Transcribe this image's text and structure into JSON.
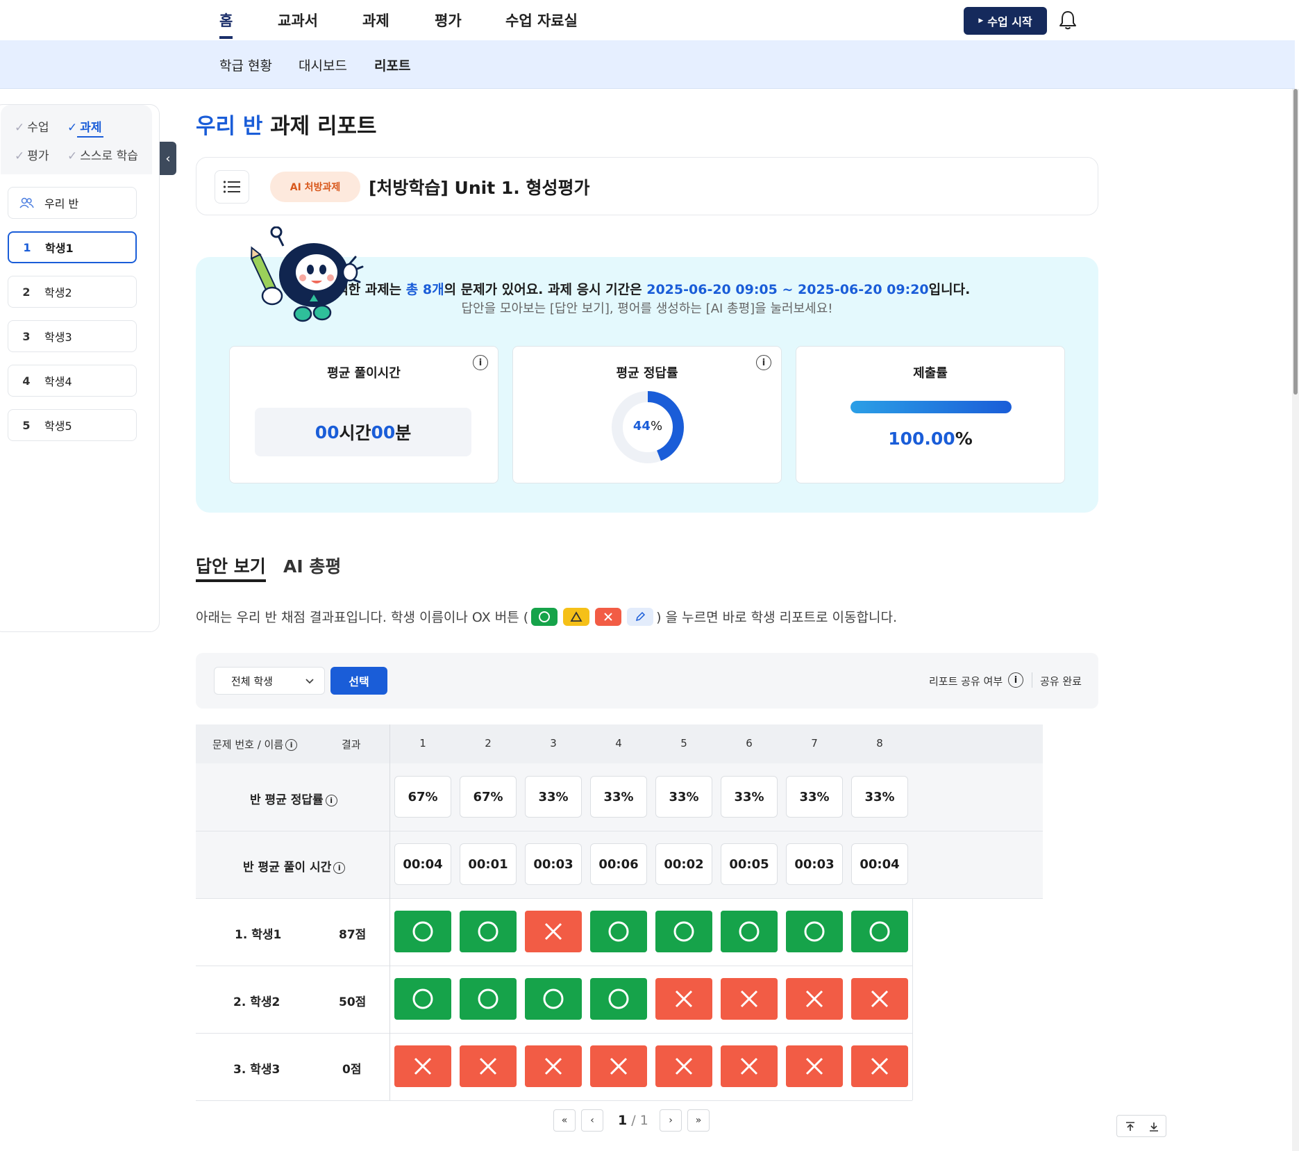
{
  "topnav": {
    "tabs": [
      "홈",
      "교과서",
      "과제",
      "평가",
      "수업 자료실"
    ],
    "start_button": "수업 시작"
  },
  "subnav": {
    "items": [
      "학급 현황",
      "대시보드",
      "리포트"
    ]
  },
  "sidebar": {
    "filters": [
      "수업",
      "과제",
      "평가",
      "스스로 학습"
    ],
    "class_label": "우리 반",
    "students": [
      {
        "num": "1",
        "name": "학생1"
      },
      {
        "num": "2",
        "name": "학생2"
      },
      {
        "num": "3",
        "name": "학생3"
      },
      {
        "num": "4",
        "name": "학생4"
      },
      {
        "num": "5",
        "name": "학생5"
      }
    ]
  },
  "header": {
    "title_highlight": "우리 반",
    "title_rest": " 과제 리포트",
    "badge": "AI 처방과제",
    "assignment_title": "[처방학습] Unit 1. 형성평가"
  },
  "info": {
    "line1_a": "선택한 과제는 ",
    "line1_count": "총 8개",
    "line1_b": "의 문제가 있어요. 과제 응시 기간은 ",
    "line1_period": "2025-06-20 09:05 ~ 2025-06-20 09:20",
    "line1_c": "입니다.",
    "line2": "답안을 모아보는 [답안 보기], 평어를 생성하는 [AI 총평]을 눌러보세요!",
    "stats": {
      "avg_time_title": "평균 풀이시간",
      "avg_time_h": "00",
      "avg_time_h_unit": "시간 ",
      "avg_time_m": "00",
      "avg_time_m_unit": "분",
      "avg_correct_title": "평균 정답률",
      "avg_correct_value": "44",
      "avg_correct_fraction": 0.44,
      "submit_title": "제출률",
      "submit_value": "100.00",
      "submit_fraction": 1.0
    }
  },
  "tabs": [
    "답안 보기",
    "AI 총평"
  ],
  "description": {
    "before": "아래는 우리 반 채점 결과표입니다. 학생 이름이나 OX 버튼 (",
    "after": ") 을 누르면 바로 학생 리포트로 이동합니다."
  },
  "filter_bar": {
    "select_value": "전체 학생",
    "select_button": "선택",
    "share_label": "리포트 공유 여부",
    "share_status": "공유 완료"
  },
  "table": {
    "header_name": "문제 번호 / 이름",
    "header_result": "결과",
    "questions": [
      "1",
      "2",
      "3",
      "4",
      "5",
      "6",
      "7",
      "8"
    ],
    "avg_correct_label": "반 평균 정답률",
    "avg_correct": [
      "67%",
      "67%",
      "33%",
      "33%",
      "33%",
      "33%",
      "33%",
      "33%"
    ],
    "avg_time_label": "반 평균 풀이 시간",
    "avg_time": [
      "00:04",
      "00:01",
      "00:03",
      "00:06",
      "00:02",
      "00:05",
      "00:03",
      "00:04"
    ],
    "students": [
      {
        "name": "1. 학생1",
        "score": "87점",
        "results": [
          "O",
          "O",
          "X",
          "O",
          "O",
          "O",
          "O",
          "O"
        ]
      },
      {
        "name": "2. 학생2",
        "score": "50점",
        "results": [
          "O",
          "O",
          "O",
          "O",
          "X",
          "X",
          "X",
          "X"
        ]
      },
      {
        "name": "3. 학생3",
        "score": "0점",
        "results": [
          "X",
          "X",
          "X",
          "X",
          "X",
          "X",
          "X",
          "X"
        ]
      }
    ]
  },
  "pagination": {
    "current": "1",
    "separator": " / ",
    "total": "1"
  },
  "colors": {
    "accent": "#1a5dd8",
    "navy": "#152a5c",
    "correct": "#16a34a",
    "wrong": "#f25c45",
    "panel": "#e4f9fd"
  },
  "icons": [
    "bell-icon",
    "list-icon",
    "users-icon",
    "chevron-left-icon",
    "info-icon",
    "chevron-down-icon",
    "circle-icon",
    "cross-icon",
    "triangle-icon",
    "pencil-icon",
    "first-page-icon",
    "prev-page-icon",
    "next-page-icon",
    "last-page-icon",
    "scroll-top-icon",
    "scroll-bottom-icon"
  ]
}
